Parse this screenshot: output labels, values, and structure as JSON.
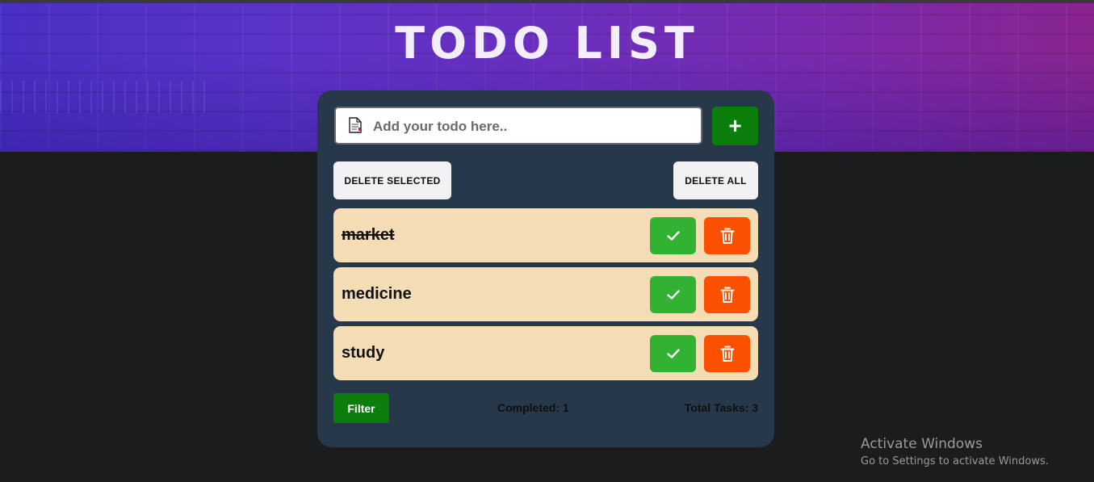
{
  "header": {
    "title": "TODO LIST"
  },
  "input": {
    "placeholder": "Add your todo here..",
    "value": ""
  },
  "actions": {
    "add_label": "+",
    "delete_selected_label": "DELETE SELECTED",
    "delete_all_label": "DELETE ALL"
  },
  "todos": [
    {
      "text": "market",
      "completed": true
    },
    {
      "text": "medicine",
      "completed": false
    },
    {
      "text": "study",
      "completed": false
    }
  ],
  "footer": {
    "filter_label": "Filter",
    "completed_text": "Completed: 1",
    "total_text": "Total Tasks: 3"
  },
  "watermark": {
    "line1": "Activate Windows",
    "line2": "Go to Settings to activate Windows."
  },
  "colors": {
    "card_bg": "#27384a",
    "todo_bg": "#f4ddb5",
    "check_green": "#31b233",
    "trash_orange": "#fb5000",
    "primary_green": "#0a7d0a"
  },
  "icons": {
    "input_icon": "document-icon",
    "check": "check-icon",
    "trash": "trash-icon"
  }
}
